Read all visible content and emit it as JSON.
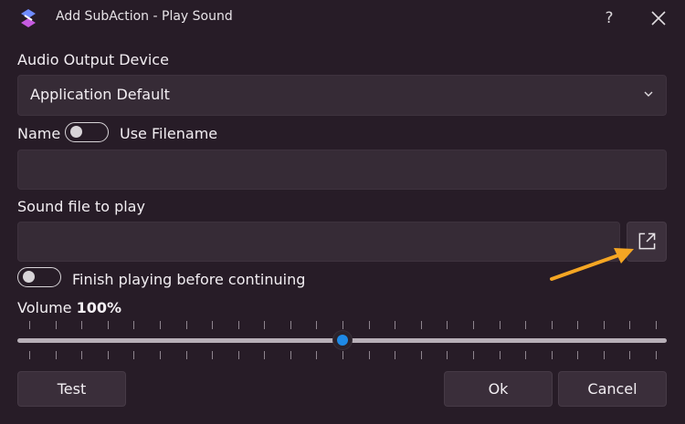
{
  "window": {
    "title": "Add SubAction - Play Sound",
    "help_label": "?",
    "close_icon": "close-icon"
  },
  "audio_output": {
    "label": "Audio Output Device",
    "selected": "Application Default"
  },
  "name": {
    "label": "Name",
    "use_filename_label": "Use Filename",
    "use_filename_on": false,
    "value": ""
  },
  "sound_file": {
    "label": "Sound file to play",
    "value": "",
    "browse_icon": "open-external-icon"
  },
  "finish_playing": {
    "label": "Finish playing before continuing",
    "on": false
  },
  "volume": {
    "label": "Volume",
    "value_label": "100%",
    "level": 0.5
  },
  "buttons": {
    "test": "Test",
    "ok": "Ok",
    "cancel": "Cancel"
  },
  "colors": {
    "background": "#271c27",
    "accent": "#1e8ae6",
    "annotation_arrow": "#f5a623"
  }
}
